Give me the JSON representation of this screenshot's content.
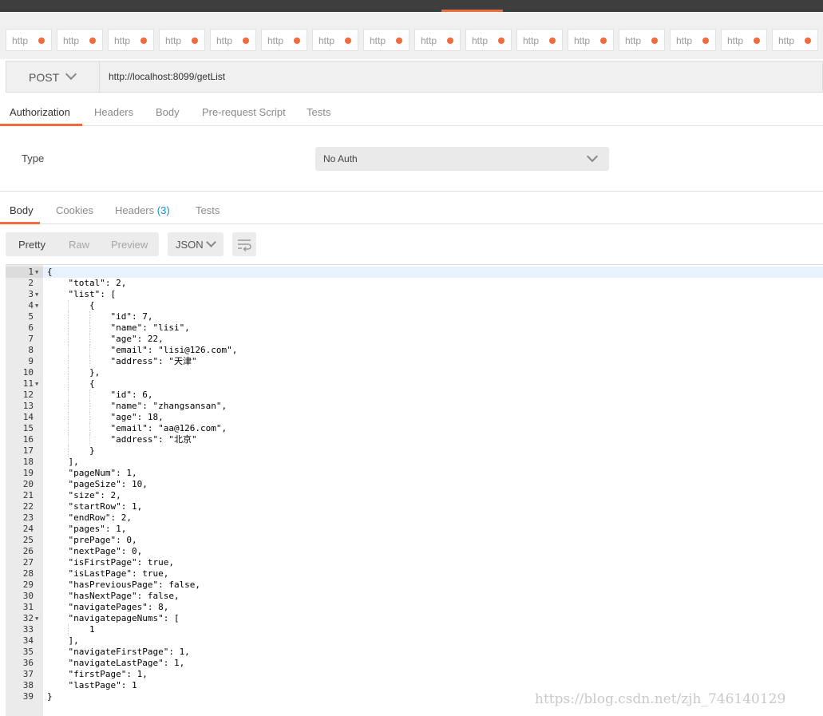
{
  "colors": {
    "accent": "#f26b3a",
    "link": "#1b8ed0",
    "topbar": "#3e3e3e"
  },
  "tabs": [
    "http",
    "http",
    "http",
    "http",
    "http",
    "http",
    "http",
    "http",
    "http",
    "http",
    "http",
    "http",
    "http",
    "http",
    "http",
    "http"
  ],
  "request": {
    "method": "POST",
    "url": "http://localhost:8099/getList"
  },
  "request_tabs": [
    "Authorization",
    "Headers",
    "Body",
    "Pre-request Script",
    "Tests"
  ],
  "auth": {
    "type_label": "Type",
    "type_value": "No Auth"
  },
  "response_tabs": {
    "body": "Body",
    "cookies": "Cookies",
    "headers": "Headers",
    "headers_count": "(3)",
    "tests": "Tests"
  },
  "view": {
    "pretty": "Pretty",
    "raw": "Raw",
    "preview": "Preview",
    "format": "JSON"
  },
  "code_lines": [
    "{",
    "    \"total\": 2,",
    "    \"list\": [",
    "        {",
    "            \"id\": 7,",
    "            \"name\": \"lisi\",",
    "            \"age\": 22,",
    "            \"email\": \"lisi@126.com\",",
    "            \"address\": \"天津\"",
    "        },",
    "        {",
    "            \"id\": 6,",
    "            \"name\": \"zhangsansan\",",
    "            \"age\": 18,",
    "            \"email\": \"aa@126.com\",",
    "            \"address\": \"北京\"",
    "        }",
    "    ],",
    "    \"pageNum\": 1,",
    "    \"pageSize\": 10,",
    "    \"size\": 2,",
    "    \"startRow\": 1,",
    "    \"endRow\": 2,",
    "    \"pages\": 1,",
    "    \"prePage\": 0,",
    "    \"nextPage\": 0,",
    "    \"isFirstPage\": true,",
    "    \"isLastPage\": true,",
    "    \"hasPreviousPage\": false,",
    "    \"hasNextPage\": false,",
    "    \"navigatePages\": 8,",
    "    \"navigatepageNums\": [",
    "        1",
    "    ],",
    "    \"navigateFirstPage\": 1,",
    "    \"navigateLastPage\": 1,",
    "    \"firstPage\": 1,",
    "    \"lastPage\": 1",
    "}"
  ],
  "fold_lines": [
    1,
    3,
    4,
    11,
    32
  ],
  "watermark": "https://blog.csdn.net/zjh_746140129"
}
